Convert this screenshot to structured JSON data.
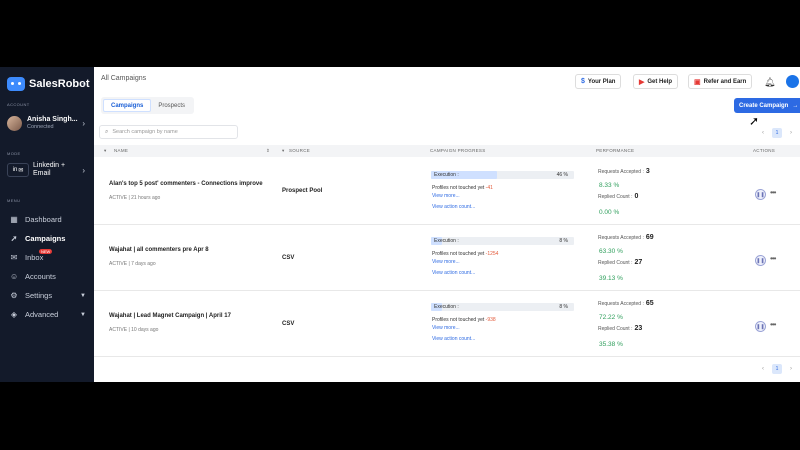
{
  "app": {
    "logo_text": "SalesRobot",
    "collapse_icon": "chevron-left-icon"
  },
  "sidebar": {
    "account_label": "ACCOUNT",
    "account_name": "Anisha Singh...",
    "account_status": "Connected",
    "mode_label": "MODE",
    "mode_text": "Linkedin + Email",
    "menu_label": "MENU",
    "items": [
      {
        "label": "Dashboard",
        "icon": "dashboard-icon",
        "glyph": "▦"
      },
      {
        "label": "Campaigns",
        "icon": "rocket-icon",
        "glyph": "➚"
      },
      {
        "label": "Inbox",
        "icon": "inbox-icon",
        "glyph": "✉",
        "badge": "NEW"
      },
      {
        "label": "Accounts",
        "icon": "accounts-icon",
        "glyph": "☺"
      },
      {
        "label": "Settings",
        "icon": "gear-icon",
        "glyph": "⚙"
      },
      {
        "label": "Advanced",
        "icon": "advanced-icon",
        "glyph": "◈"
      }
    ]
  },
  "header": {
    "title": "All Campaigns",
    "your_plan": "Your Plan",
    "get_help": "Get Help",
    "refer": "Refer and Earn"
  },
  "tabs": {
    "campaigns": "Campaigns",
    "prospects": "Prospects"
  },
  "create_button": "Create Campaign",
  "search": {
    "placeholder": "Search campaign by name"
  },
  "pagination": {
    "page": "1"
  },
  "table": {
    "headers": {
      "name": "NAME",
      "source": "SOURCE",
      "progress": "CAMPAIGN PROGRESS",
      "performance": "PERFORMANCE",
      "actions": "ACTIONS"
    },
    "rows": [
      {
        "name": "Alan's top 5 post' commenters - Connections improve",
        "meta": "ACTIVE | 21 hours ago",
        "source": "Prospect Pool",
        "execution_label": "Execution :",
        "execution_pct_text": "46 %",
        "execution_fraction": 0.46,
        "not_touched_label": "Profiles not touched yet",
        "not_touched_value": "-41",
        "view_more": "View more...",
        "view_action": "View action count...",
        "requests_label": "Requests Accepted :",
        "requests_value": "3",
        "requests_pct": "8.33 %",
        "replied_label": "Replied Count :",
        "replied_value": "0",
        "replied_pct": "0.00 %"
      },
      {
        "name": "Wajahat | all commenters pre Apr 8",
        "meta": "ACTIVE | 7 days ago",
        "source": "CSV",
        "execution_label": "Execution :",
        "execution_pct_text": "8 %",
        "execution_fraction": 0.08,
        "not_touched_label": "Profiles not touched yet",
        "not_touched_value": "-1254",
        "view_more": "View more...",
        "view_action": "View action count...",
        "requests_label": "Requests Accepted :",
        "requests_value": "69",
        "requests_pct": "63.30 %",
        "replied_label": "Replied Count :",
        "replied_value": "27",
        "replied_pct": "39.13 %"
      },
      {
        "name": "Wajahat | Lead Magnet Campaign | April 17",
        "meta": "ACTIVE | 10 days ago",
        "source": "CSV",
        "execution_label": "Execution :",
        "execution_pct_text": "8 %",
        "execution_fraction": 0.08,
        "not_touched_label": "Profiles not touched yet",
        "not_touched_value": "-938",
        "view_more": "View more...",
        "view_action": "View action count...",
        "requests_label": "Requests Accepted :",
        "requests_value": "65",
        "requests_pct": "72.22 %",
        "replied_label": "Replied Count :",
        "replied_value": "23",
        "replied_pct": "35.38 %"
      }
    ]
  },
  "colors": {
    "sidebar_bg": "#131a2a",
    "accent": "#2d6ae3",
    "positive": "#2e9e5b",
    "negative": "#e35b3b"
  }
}
